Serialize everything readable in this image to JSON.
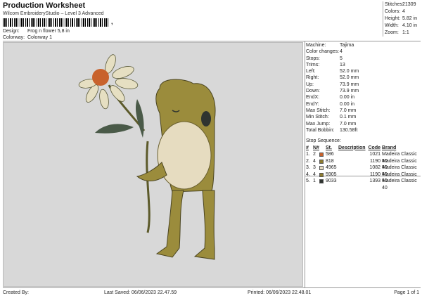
{
  "header": {
    "title": "Production Worksheet",
    "subtitle": "Wilcom EmbroideryStudio – Level 3 Advanced",
    "barcode_tail": ",",
    "design_label": "Design:",
    "design_value": "Frog n flower 5,8 in",
    "colorway_label": "Colorway:",
    "colorway_value": "Colorway 1"
  },
  "topstats": [
    {
      "label": "Stitches:",
      "value": "21309"
    },
    {
      "label": "Colors:",
      "value": "4"
    },
    {
      "label": "Height:",
      "value": "5.82 in"
    },
    {
      "label": "Width:",
      "value": "4.10 in"
    },
    {
      "label": "Zoom:",
      "value": "1:1"
    }
  ],
  "params": [
    {
      "label": "Machine:",
      "value": "Tajima"
    },
    {
      "label": "Color changes:",
      "value": "4"
    },
    {
      "label": "Stops:",
      "value": "5"
    },
    {
      "label": "Trims:",
      "value": "13"
    },
    {
      "label": "Left:",
      "value": "52.0 mm"
    },
    {
      "label": "Right:",
      "value": "52.0 mm"
    },
    {
      "label": "Up:",
      "value": "73.9 mm"
    },
    {
      "label": "Down:",
      "value": "73.9 mm"
    },
    {
      "label": "EndX:",
      "value": "0.00 in"
    },
    {
      "label": "EndY:",
      "value": "0.00 in"
    },
    {
      "label": "Max Stitch:",
      "value": "7.0 mm"
    },
    {
      "label": "Min Stitch:",
      "value": "0.1 mm"
    },
    {
      "label": "Max Jump:",
      "value": "7.0 mm"
    },
    {
      "label": "Total Bobbin:",
      "value": "130.58ft"
    }
  ],
  "stops": {
    "title": "Stop Sequence:",
    "headers": [
      "#",
      "N#",
      "",
      "St.",
      "Description",
      "Code",
      "Brand"
    ],
    "rows": [
      {
        "num": "1.",
        "n": "2",
        "color": "#c8622c",
        "st": "586",
        "desc": "",
        "code": "1021",
        "brand": "Madeira Classic 40"
      },
      {
        "num": "2.",
        "n": "4",
        "color": "#8c7a2e",
        "st": "818",
        "desc": "",
        "code": "1190",
        "brand": "Madeira Classic 40"
      },
      {
        "num": "3.",
        "n": "3",
        "color": "#e6dcc0",
        "st": "4965",
        "desc": "",
        "code": "1082",
        "brand": "Madeira Classic 40"
      },
      {
        "num": "4.",
        "n": "4",
        "color": "#8c7a2e",
        "st": "5905",
        "desc": "",
        "code": "1190",
        "brand": "Madeira Classic 40"
      },
      {
        "num": "5.",
        "n": "1",
        "color": "#2f3430",
        "st": "9033",
        "desc": "",
        "code": "1393",
        "brand": "Madeira Classic 40"
      }
    ]
  },
  "footer": {
    "created": "Created By:",
    "saved": "Last Saved: 06/06/2023 22.47.59",
    "printed": "Printed: 06/06/2023 22.48.01",
    "page": "Page 1 of 1"
  }
}
